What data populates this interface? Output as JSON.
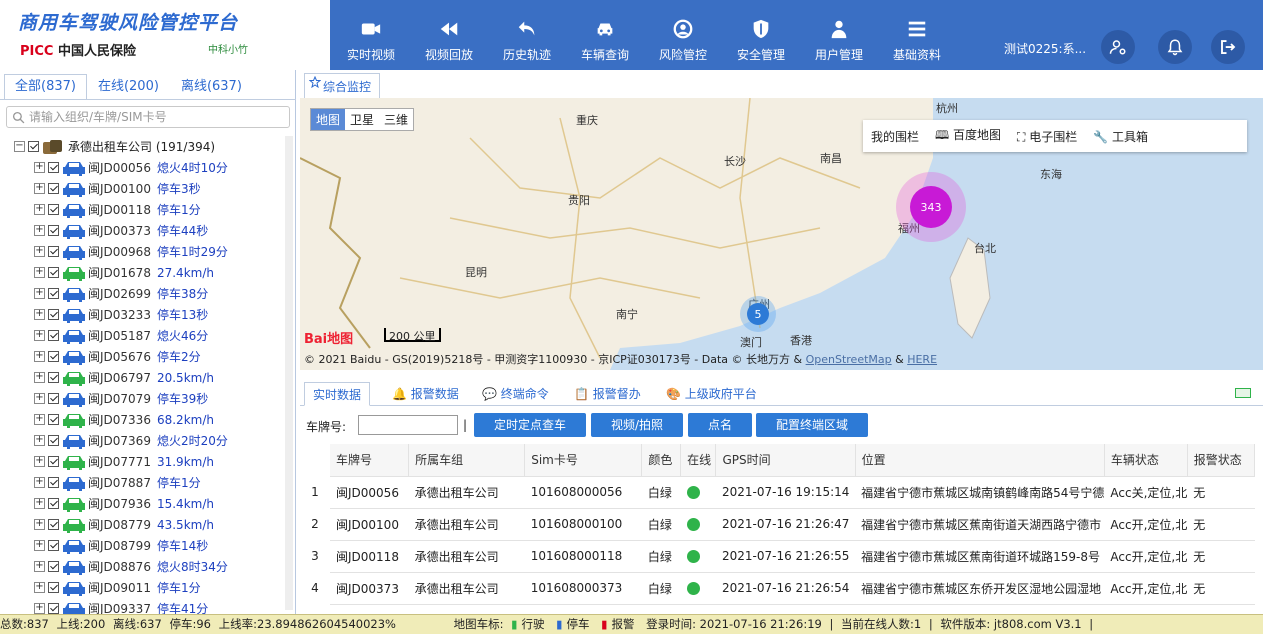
{
  "logo": {
    "title": "商用车驾驶风险管控平台",
    "picc": "PICC",
    "company": "中国人民保险",
    "partner": "中科小竹"
  },
  "nav": [
    {
      "label": "实时视频",
      "icon": "video-camera-icon"
    },
    {
      "label": "视频回放",
      "icon": "rewind-icon"
    },
    {
      "label": "历史轨迹",
      "icon": "return-arrow-icon"
    },
    {
      "label": "车辆查询",
      "icon": "car-icon"
    },
    {
      "label": "风险管控",
      "icon": "face-icon"
    },
    {
      "label": "安全管理",
      "icon": "shield-icon"
    },
    {
      "label": "用户管理",
      "icon": "user-icon"
    },
    {
      "label": "基础资料",
      "icon": "list-icon"
    }
  ],
  "user": {
    "name": "测试0225:系..."
  },
  "sidebar": {
    "tabs": [
      "全部(837)",
      "在线(200)",
      "离线(637)"
    ],
    "search_placeholder": "请输入组织/车牌/SIM卡号",
    "group": "承德出租车公司 (191/394)",
    "vehicles": [
      {
        "plate": "闽JD00056",
        "status": "熄火4时10分",
        "color": "blue"
      },
      {
        "plate": "闽JD00100",
        "status": "停车3秒",
        "color": "blue"
      },
      {
        "plate": "闽JD00118",
        "status": "停车1分",
        "color": "blue"
      },
      {
        "plate": "闽JD00373",
        "status": "停车44秒",
        "color": "blue"
      },
      {
        "plate": "闽JD00968",
        "status": "停车1时29分",
        "color": "blue"
      },
      {
        "plate": "闽JD01678",
        "status": "27.4km/h",
        "color": "green"
      },
      {
        "plate": "闽JD02699",
        "status": "停车38分",
        "color": "blue"
      },
      {
        "plate": "闽JD03233",
        "status": "停车13秒",
        "color": "blue"
      },
      {
        "plate": "闽JD05187",
        "status": "熄火46分",
        "color": "blue"
      },
      {
        "plate": "闽JD05676",
        "status": "停车2分",
        "color": "blue"
      },
      {
        "plate": "闽JD06797",
        "status": "20.5km/h",
        "color": "green"
      },
      {
        "plate": "闽JD07079",
        "status": "停车39秒",
        "color": "blue"
      },
      {
        "plate": "闽JD07336",
        "status": "68.2km/h",
        "color": "green"
      },
      {
        "plate": "闽JD07369",
        "status": "熄火2时20分",
        "color": "blue"
      },
      {
        "plate": "闽JD07771",
        "status": "31.9km/h",
        "color": "green"
      },
      {
        "plate": "闽JD07887",
        "status": "停车1分",
        "color": "blue"
      },
      {
        "plate": "闽JD07936",
        "status": "15.4km/h",
        "color": "green"
      },
      {
        "plate": "闽JD08779",
        "status": "43.5km/h",
        "color": "green"
      },
      {
        "plate": "闽JD08799",
        "status": "停车14秒",
        "color": "blue"
      },
      {
        "plate": "闽JD08876",
        "status": "熄火8时34分",
        "color": "blue"
      },
      {
        "plate": "闽JD09011",
        "status": "停车1分",
        "color": "blue"
      },
      {
        "plate": "闽JD09337",
        "status": "停车41分",
        "color": "blue"
      }
    ]
  },
  "main_tab": "综合监控",
  "map": {
    "types": [
      "地图",
      "卫星",
      "三维"
    ],
    "tools": [
      "我的围栏",
      "百度地图",
      "电子围栏",
      "工具箱"
    ],
    "cities": [
      "杭州",
      "重庆",
      "长沙",
      "南昌",
      "贵阳",
      "东海",
      "福州",
      "台北",
      "昆明",
      "南宁",
      "广州",
      "澳门",
      "香港"
    ],
    "clusters": [
      "343",
      "5"
    ],
    "scale": "200 公里",
    "baidu": "Bai地图",
    "copyright": "© 2021 Baidu - GS(2019)5218号 - 甲测资字1100930 - 京ICP证030173号 - Data © 长地万方 &",
    "osm": "OpenStreetMap",
    "and": "&",
    "here": "HERE"
  },
  "data_tabs": [
    "实时数据",
    "报警数据",
    "终端命令",
    "报警督办",
    "上级政府平台"
  ],
  "toolbar": {
    "plate_label": "车牌号:",
    "sep": "|",
    "buttons": [
      "定时定点查车",
      "视频/拍照",
      "点名",
      "配置终端区域"
    ]
  },
  "table": {
    "headers": [
      "车牌号",
      "所属车组",
      "Sim卡号",
      "颜色",
      "在线",
      "GPS时间",
      "位置",
      "车辆状态",
      "报警状态"
    ],
    "rows": [
      {
        "n": "1",
        "plate": "闽JD00056",
        "group": "承德出租车公司",
        "sim": "101608000056",
        "color": "白绿",
        "gps": "2021-07-16 19:15:14",
        "loc": "福建省宁德市蕉城区城南镇鹤峰南路54号宁德",
        "state": "Acc关,定位,北",
        "alarm": "无"
      },
      {
        "n": "2",
        "plate": "闽JD00100",
        "group": "承德出租车公司",
        "sim": "101608000100",
        "color": "白绿",
        "gps": "2021-07-16 21:26:47",
        "loc": "福建省宁德市蕉城区蕉南街道天湖西路宁德市",
        "state": "Acc开,定位,北",
        "alarm": "无"
      },
      {
        "n": "3",
        "plate": "闽JD00118",
        "group": "承德出租车公司",
        "sim": "101608000118",
        "color": "白绿",
        "gps": "2021-07-16 21:26:55",
        "loc": "福建省宁德市蕉城区蕉南街道环城路159-8号",
        "state": "Acc开,定位,北",
        "alarm": "无"
      },
      {
        "n": "4",
        "plate": "闽JD00373",
        "group": "承德出租车公司",
        "sim": "101608000373",
        "color": "白绿",
        "gps": "2021-07-16 21:26:54",
        "loc": "福建省宁德市蕉城区东侨开发区湿地公园湿地",
        "state": "Acc开,定位,北",
        "alarm": "无"
      }
    ]
  },
  "statusbar": {
    "total": "总数:837",
    "online": "上线:200",
    "offline": "离线:637",
    "parked": "停车:96",
    "rate": "上线率:23.894862604540023%",
    "legend": "地图车标:",
    "driving": "行驶",
    "stop": "停车",
    "alarm": "报警",
    "login": "登录时间: 2021-07-16 21:26:19",
    "sep": "|",
    "current": "当前在线人数:1",
    "version": "软件版本: jt808.com V3.1"
  }
}
